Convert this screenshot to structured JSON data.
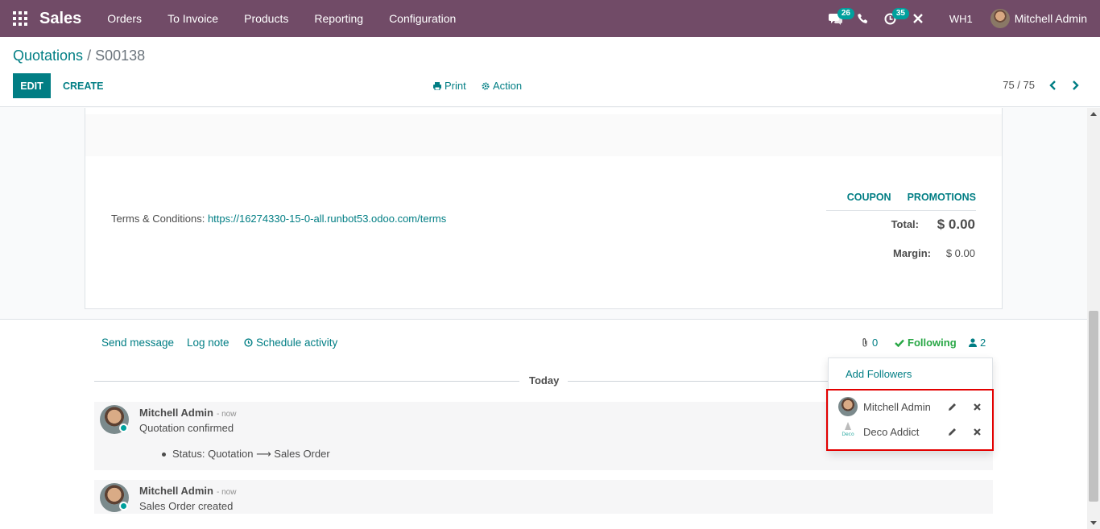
{
  "navbar": {
    "brand": "Sales",
    "menu": [
      "Orders",
      "To Invoice",
      "Products",
      "Reporting",
      "Configuration"
    ],
    "messages_count": "26",
    "activities_count": "35",
    "company": "WH1",
    "user": "Mitchell Admin"
  },
  "control": {
    "breadcrumb_parent": "Quotations",
    "breadcrumb_sep": "/",
    "breadcrumb_current": "S00138",
    "edit_label": "EDIT",
    "create_label": "CREATE",
    "print_label": "Print",
    "action_label": "Action",
    "pager": "75 / 75"
  },
  "sheet": {
    "terms_label": "Terms & Conditions:",
    "terms_link": "https://16274330-15-0-all.runbot53.odoo.com/terms",
    "coupon_label": "COUPON",
    "promotions_label": "PROMOTIONS",
    "total_label": "Total:",
    "total_value": "$ 0.00",
    "margin_label": "Margin:",
    "margin_value": "$ 0.00"
  },
  "chatter": {
    "send_message": "Send message",
    "log_note": "Log note",
    "schedule_activity": "Schedule activity",
    "attachments_count": "0",
    "following_label": "Following",
    "followers_count": "2",
    "today_label": "Today",
    "messages": [
      {
        "author": "Mitchell Admin",
        "time": "- now",
        "body": "Quotation confirmed",
        "tracking": "Status: Quotation ⟶ Sales Order"
      },
      {
        "author": "Mitchell Admin",
        "time": "- now",
        "body": "Sales Order created"
      }
    ]
  },
  "followers_dropdown": {
    "add_followers": "Add Followers",
    "followers": [
      "Mitchell Admin",
      "Deco Addict"
    ]
  }
}
